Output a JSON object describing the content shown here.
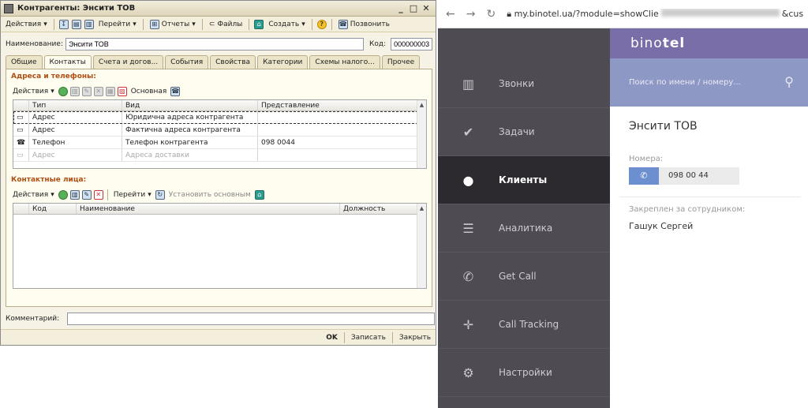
{
  "window": {
    "title": "Контрагенты: Энсити ТОВ",
    "toolbar": {
      "actions": "Действия",
      "goto": "Перейти",
      "reports": "Отчеты",
      "files": "Файлы",
      "create": "Создать",
      "call": "Позвонить",
      "help": "?"
    },
    "name_label": "Наименование:",
    "name_value": "Энсити ТОВ",
    "code_label": "Код:",
    "code_value": "000000003",
    "tabs": [
      "Общие",
      "Контакты",
      "Счета и догов...",
      "События",
      "Свойства",
      "Категории",
      "Схемы налого...",
      "Прочее"
    ],
    "addresses": {
      "title": "Адреса и телефоны:",
      "actions": "Действия",
      "main_label": "Основная",
      "columns": [
        "Тип",
        "Вид",
        "Представление"
      ],
      "rows": [
        {
          "type": "Адрес",
          "kind": "Юридична адреса контрагента",
          "view": ""
        },
        {
          "type": "Адрес",
          "kind": "Фактична адреса контрагента",
          "view": ""
        },
        {
          "type": "Телефон",
          "kind": "Телефон контрагента",
          "view": "098      0044"
        },
        {
          "type": "Адрес",
          "kind": "Адреса доставки",
          "view": ""
        }
      ]
    },
    "contacts": {
      "title": "Контактные лица:",
      "actions": "Действия",
      "goto": "Перейти",
      "set_main": "Установить основным",
      "columns": [
        "Код",
        "Наименование",
        "Должность"
      ]
    },
    "comment_label": "Комментарий:",
    "comment_value": "",
    "buttons": {
      "ok": "OK",
      "save": "Записать",
      "close": "Закрыть"
    }
  },
  "browser": {
    "url": "my.binotel.ua/?module=showClie",
    "url_tail": "&cus",
    "logo_light": "bino",
    "logo_bold": "tel",
    "search_placeholder": "Поиск по имени / номеру...",
    "nav": [
      {
        "label": "Звонки",
        "icon": "calls-icon"
      },
      {
        "label": "Задачи",
        "icon": "check-icon"
      },
      {
        "label": "Клиенты",
        "icon": "user-icon"
      },
      {
        "label": "Аналитика",
        "icon": "analytics-icon"
      },
      {
        "label": "Get Call",
        "icon": "phone-icon"
      },
      {
        "label": "Call Tracking",
        "icon": "tracking-icon"
      },
      {
        "label": "Настройки",
        "icon": "gear-icon"
      }
    ],
    "client": {
      "name": "Энсити ТОВ",
      "numbers_label": "Номера:",
      "number": "098       00 44",
      "assigned_label": "Закреплен за сотрудником:",
      "assigned_to": "Гашук Сергей"
    }
  }
}
